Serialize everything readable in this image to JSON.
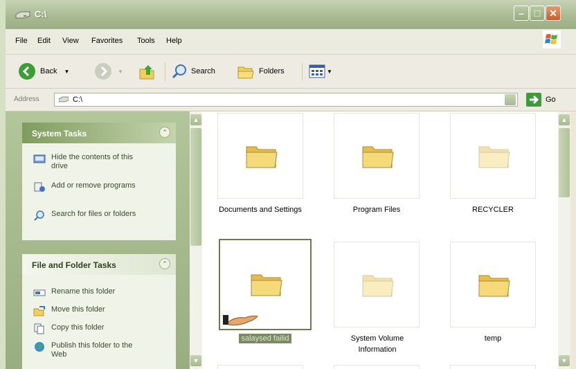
{
  "window": {
    "title": "C:\\"
  },
  "menu": [
    "File",
    "Edit",
    "View",
    "Favorites",
    "Tools",
    "Help"
  ],
  "toolbar": {
    "back": "Back",
    "search": "Search",
    "folders": "Folders"
  },
  "address": {
    "label": "Address",
    "path": "C:\\",
    "go": "Go"
  },
  "system_tasks": {
    "title": "System Tasks",
    "items": [
      "Hide the contents of this drive",
      "Add or remove programs",
      "Search for files or folders"
    ]
  },
  "file_folder_tasks": {
    "title": "File and Folder Tasks",
    "items": [
      "Rename this folder",
      "Move this folder",
      "Copy this folder",
      "Publish this folder to the Web"
    ]
  },
  "folders": [
    {
      "name": "Documents and Settings",
      "faded": false,
      "selected": false,
      "shared": false
    },
    {
      "name": "Program Files",
      "faded": false,
      "selected": false,
      "shared": false
    },
    {
      "name": "RECYCLER",
      "faded": true,
      "selected": false,
      "shared": false
    },
    {
      "name": "salaysed failid",
      "faded": false,
      "selected": true,
      "shared": true
    },
    {
      "name": "System Volume Information",
      "faded": true,
      "selected": false,
      "shared": false
    },
    {
      "name": "temp",
      "faded": false,
      "selected": false,
      "shared": false
    }
  ],
  "colors": {
    "titlebar": "#a8b990",
    "taskpane": "#a3b68a",
    "selection": "#7a8a63",
    "folder": "#f3d26a"
  }
}
